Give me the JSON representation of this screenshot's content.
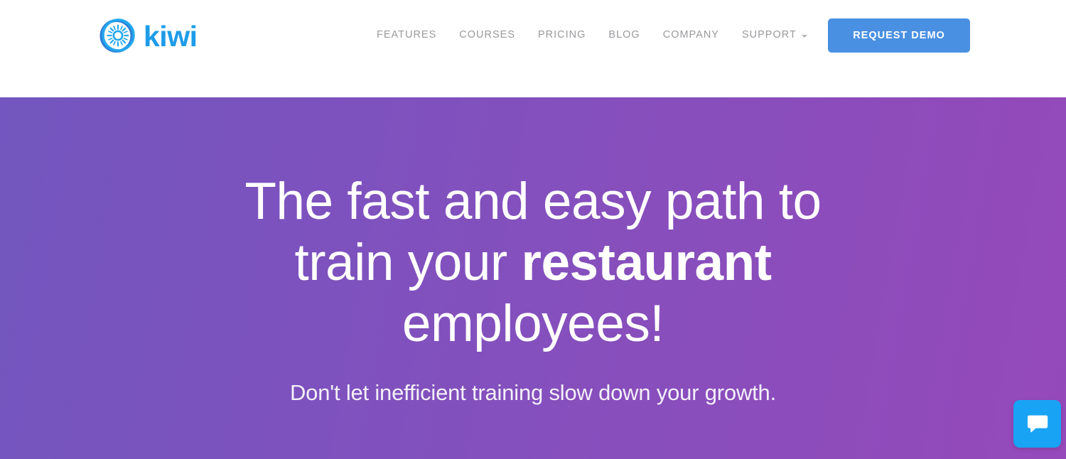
{
  "header": {
    "brand": {
      "icon": "kiwi-fruit-slice-icon",
      "word": "kiwi",
      "color": "#1e9ce8"
    },
    "nav": [
      {
        "label": "FEATURES",
        "has_dropdown": false
      },
      {
        "label": "COURSES",
        "has_dropdown": false
      },
      {
        "label": "PRICING",
        "has_dropdown": false
      },
      {
        "label": "BLOG",
        "has_dropdown": false
      },
      {
        "label": "COMPANY",
        "has_dropdown": false
      },
      {
        "label": "SUPPORT",
        "has_dropdown": true
      }
    ],
    "cta": {
      "label": "REQUEST DEMO",
      "color": "#4a90e2"
    }
  },
  "hero": {
    "title_line1": "The fast and easy path to",
    "title_line2_pre": "train your ",
    "title_line2_bold": "restaurant",
    "title_line3": "employees!",
    "subtitle": "Don't let inefficient training slow down your growth.",
    "gradient_from": "#7356bf",
    "gradient_to": "#9549ba"
  },
  "chat": {
    "icon": "chat-bubble-icon",
    "color": "#19a3f5"
  }
}
